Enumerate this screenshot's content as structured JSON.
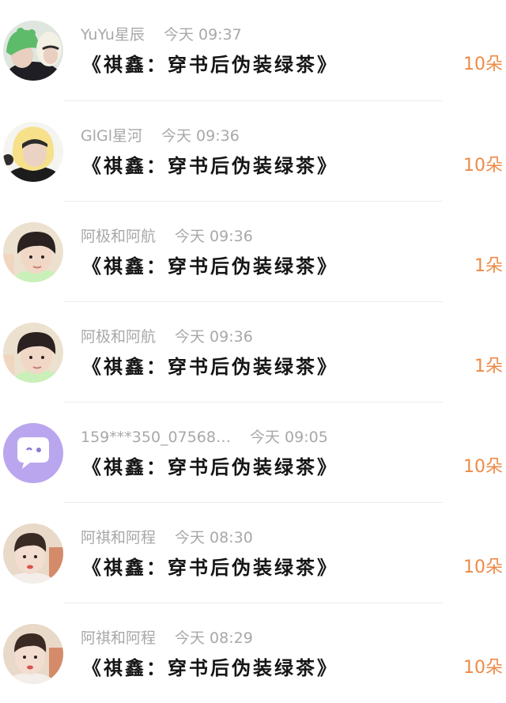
{
  "gifts": [
    {
      "user": "YuYu星辰",
      "time": "今天 09:37",
      "title": "《祺鑫：穿书后伪装绿茶》",
      "count": "10朵",
      "avatar": "green-hat-avatar"
    },
    {
      "user": "GlGl星河",
      "time": "今天 09:36",
      "title": "《祺鑫：穿书后伪装绿茶》",
      "count": "10朵",
      "avatar": "yellow-hat-avatar"
    },
    {
      "user": "阿极和阿航",
      "time": "今天 09:36",
      "title": "《祺鑫：穿书后伪装绿茶》",
      "count": "1朵",
      "avatar": "boy-portrait-avatar"
    },
    {
      "user": "阿极和阿航",
      "time": "今天 09:36",
      "title": "《祺鑫：穿书后伪装绿茶》",
      "count": "1朵",
      "avatar": "boy-portrait-avatar"
    },
    {
      "user": "159***350_07568…",
      "time": "今天 09:05",
      "title": "《祺鑫：穿书后伪装绿茶》",
      "count": "10朵",
      "avatar": "chat-bubble-default-avatar"
    },
    {
      "user": "阿祺和阿程",
      "time": "今天 08:30",
      "title": "《祺鑫：穿书后伪装绿茶》",
      "count": "10朵",
      "avatar": "boy-pale-avatar"
    },
    {
      "user": "阿祺和阿程",
      "time": "今天 08:29",
      "title": "《祺鑫：穿书后伪装绿茶》",
      "count": "10朵",
      "avatar": "boy-pale-avatar"
    }
  ],
  "colors": {
    "count": "#ee8a47",
    "meta": "#a8a8a8",
    "title": "#151515",
    "default_avatar_bg": "#b9a6ee"
  }
}
